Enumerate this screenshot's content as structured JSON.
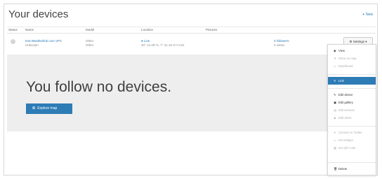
{
  "header": {
    "title": "Your devices",
    "new_label": "New"
  },
  "table": {
    "columns": [
      "Status",
      "Name",
      "Model",
      "Location",
      "Pictures"
    ],
    "row": {
      "name": "test.Weatherlink.com VP2",
      "name_sub": "Unknown",
      "model": "Other",
      "model_sub": "Other",
      "location_label": "Live",
      "location_coords": "40° 14.48' N, 7° 21.16' E 0 m/s",
      "followers": "0 followers",
      "followers_sub": "0 views",
      "settings_label": "Settings"
    }
  },
  "empty_state": {
    "message": "You follow no devices.",
    "explore_label": "Explore map"
  },
  "settings_menu": {
    "items": [
      {
        "label": "View",
        "icon": "eye-icon",
        "state": "normal"
      },
      {
        "label": "Show on map",
        "icon": "map-marker-icon",
        "state": "disabled"
      },
      {
        "label": "Dashboard",
        "icon": "dashboard-icon",
        "state": "disabled"
      },
      {
        "label": "Link",
        "icon": "link-icon",
        "state": "active"
      },
      {
        "label": "Edit device",
        "icon": "pencil-icon",
        "state": "normal"
      },
      {
        "label": "Edit gallery",
        "icon": "image-icon",
        "state": "normal"
      },
      {
        "label": "Edit sensors",
        "icon": "sensor-icon",
        "state": "disabled"
      },
      {
        "label": "Edit alerts",
        "icon": "bell-icon",
        "state": "disabled"
      },
      {
        "label": "Connect to Twitter",
        "icon": "twitter-icon",
        "state": "disabled"
      },
      {
        "label": "Get Widget",
        "icon": "widget-icon",
        "state": "disabled"
      },
      {
        "label": "Get QR code",
        "icon": "qr-code-icon",
        "state": "disabled"
      },
      {
        "label": "Delete",
        "icon": "trash-icon",
        "state": "normal"
      }
    ]
  },
  "colors": {
    "accent": "#2e7cb6",
    "link": "#2a7ab8",
    "panel": "#eeeeee"
  }
}
